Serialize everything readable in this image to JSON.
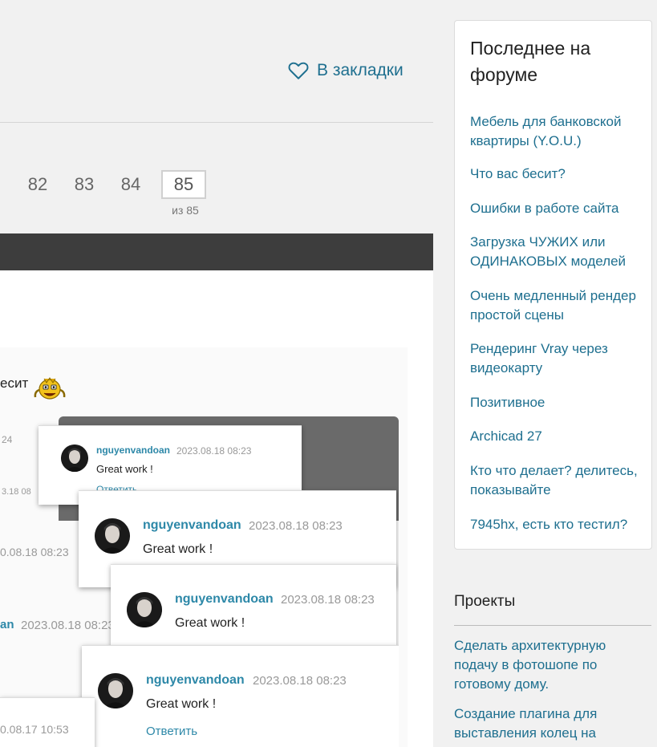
{
  "bookmark": {
    "label": "В закладки"
  },
  "pagination": {
    "pages": [
      "82",
      "83",
      "84"
    ],
    "current": "85",
    "of_label": "из 85"
  },
  "post": {
    "text_fragment": "есит"
  },
  "screenshot": {
    "fragments": {
      "t1": "24",
      "t2": "3.18 08",
      "t3": "0.08.18 08:23",
      "t4": "an",
      "t5": "2023.08.18 08:23",
      "t6": "0.08.17 10:53"
    },
    "comments": [
      {
        "user": "nguyenvandoan",
        "timestamp": "2023.08.18 08:23",
        "message": "Great work !",
        "reply": "Ответить"
      },
      {
        "user": "nguyenvandoan",
        "timestamp": "2023.08.18 08:23",
        "message": "Great work !"
      },
      {
        "user": "nguyenvandoan",
        "timestamp": "2023.08.18 08:23",
        "message": "Great work !"
      },
      {
        "user": "nguyenvandoan",
        "timestamp": "2023.08.18 08:23",
        "message": "Great work !",
        "reply": "Ответить"
      }
    ]
  },
  "sidebar": {
    "title": "Последнее на форуме",
    "links": [
      "Мебель для банковской квартиры (Y.O.U.)",
      "Что вас бесит?",
      "Ошибки в работе сайта",
      "Загрузка ЧУЖИХ или ОДИНАКОВЫХ моделей",
      "Очень медленный рендер простой сцены",
      "Рендеринг Vray через видеокарту",
      "Позитивное",
      "Archicad 27",
      "Кто что делает? делитесь, показывайте",
      "7945hx, есть кто тестил?"
    ]
  },
  "projects": {
    "title": "Проекты",
    "links": [
      "Сделать архитектурную подачу в фотошопе по готовому дому.",
      "Создание плагина для выставления колец на"
    ]
  },
  "colors": {
    "link": "#1e6f8f",
    "username": "#2d88a8",
    "darkbar": "#3d3d3d"
  }
}
